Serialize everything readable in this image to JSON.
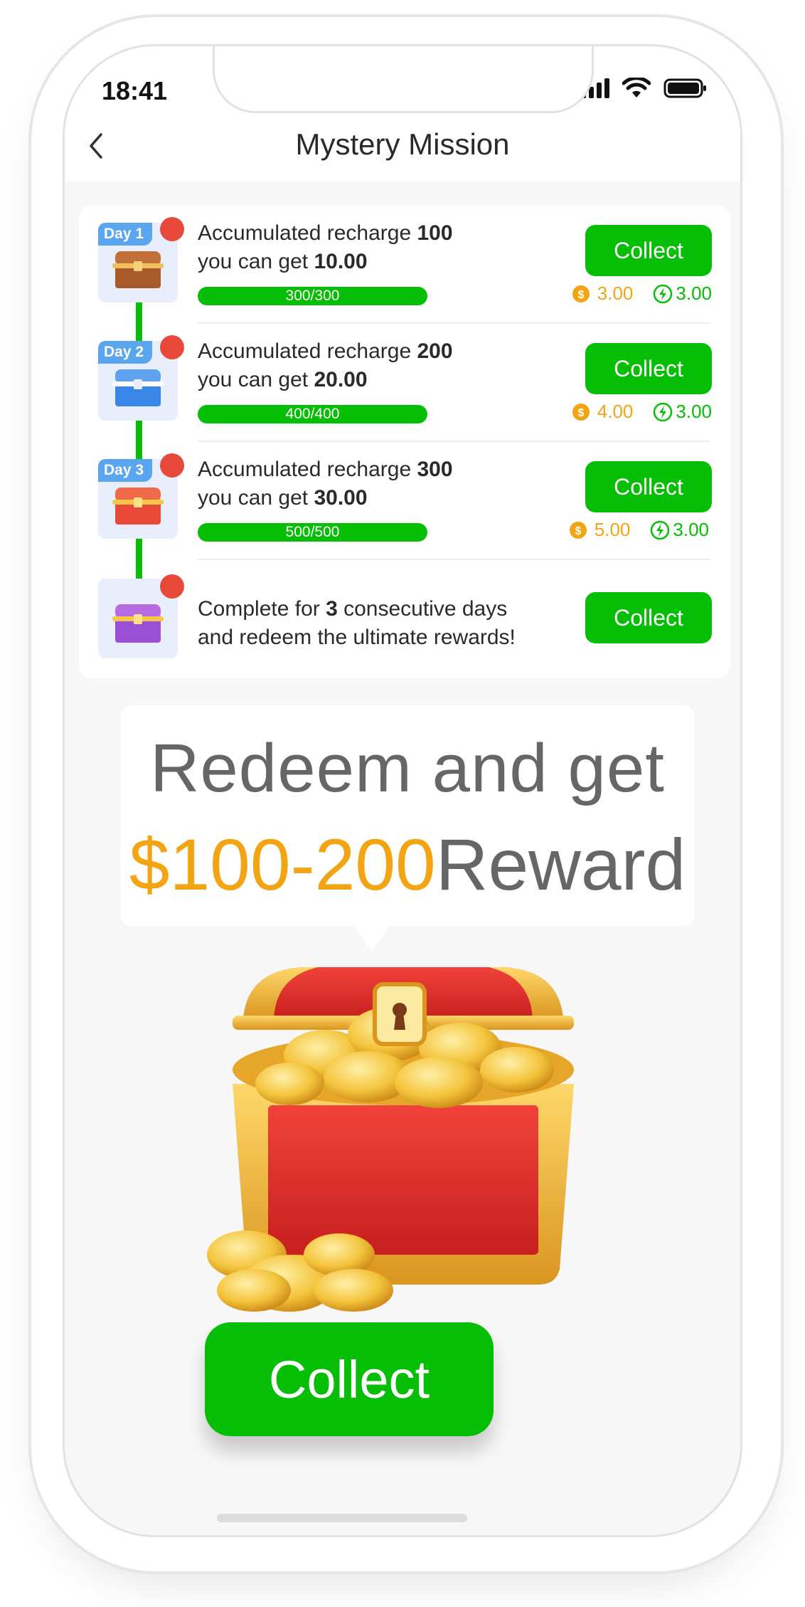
{
  "status_bar": {
    "time": "18:41",
    "icons": [
      "signal-icon",
      "wifi-icon",
      "battery-icon"
    ]
  },
  "nav": {
    "title": "Mystery Mission",
    "back_icon": "chevron-left-icon"
  },
  "missions": [
    {
      "day": "Day 1",
      "line1_prefix": "Accumulated recharge ",
      "line1_value": "100",
      "line2_prefix": "you can get ",
      "line2_value": "10.00",
      "progress_text": "300/300",
      "progress": 1.0,
      "button": "Collect",
      "coin_reward": "3.00",
      "bolt_reward": "3.00",
      "chest_color": "#b8602e"
    },
    {
      "day": "Day 2",
      "line1_prefix": "Accumulated recharge ",
      "line1_value": "200",
      "line2_prefix": "you can get ",
      "line2_value": "20.00",
      "progress_text": "400/400",
      "progress": 1.0,
      "button": "Collect",
      "coin_reward": "4.00",
      "bolt_reward": "3.00",
      "chest_color": "#3a86e8"
    },
    {
      "day": "Day 3",
      "line1_prefix": "Accumulated recharge ",
      "line1_value": "300",
      "line2_prefix": "you can get ",
      "line2_value": "30.00",
      "progress_text": "500/500",
      "progress": 1.0,
      "button": "Collect",
      "coin_reward": "5.00",
      "bolt_reward": "3.00",
      "chest_color": "#e84a3a"
    }
  ],
  "final_mission": {
    "line1_prefix": "Complete for ",
    "line1_value": "3",
    "line1_suffix": " consecutive days",
    "line2": "and redeem the ultimate rewards!",
    "button": "Collect",
    "chest_color": "#9b4fd6"
  },
  "banner": {
    "line1": "Redeem and get",
    "amount": "$100-200",
    "suffix": "Reward"
  },
  "main_button": "Collect",
  "colors": {
    "green": "#06be06",
    "orange": "#f3a412",
    "red_dot": "#e8493b",
    "day_tag": "#5aa6ee"
  }
}
